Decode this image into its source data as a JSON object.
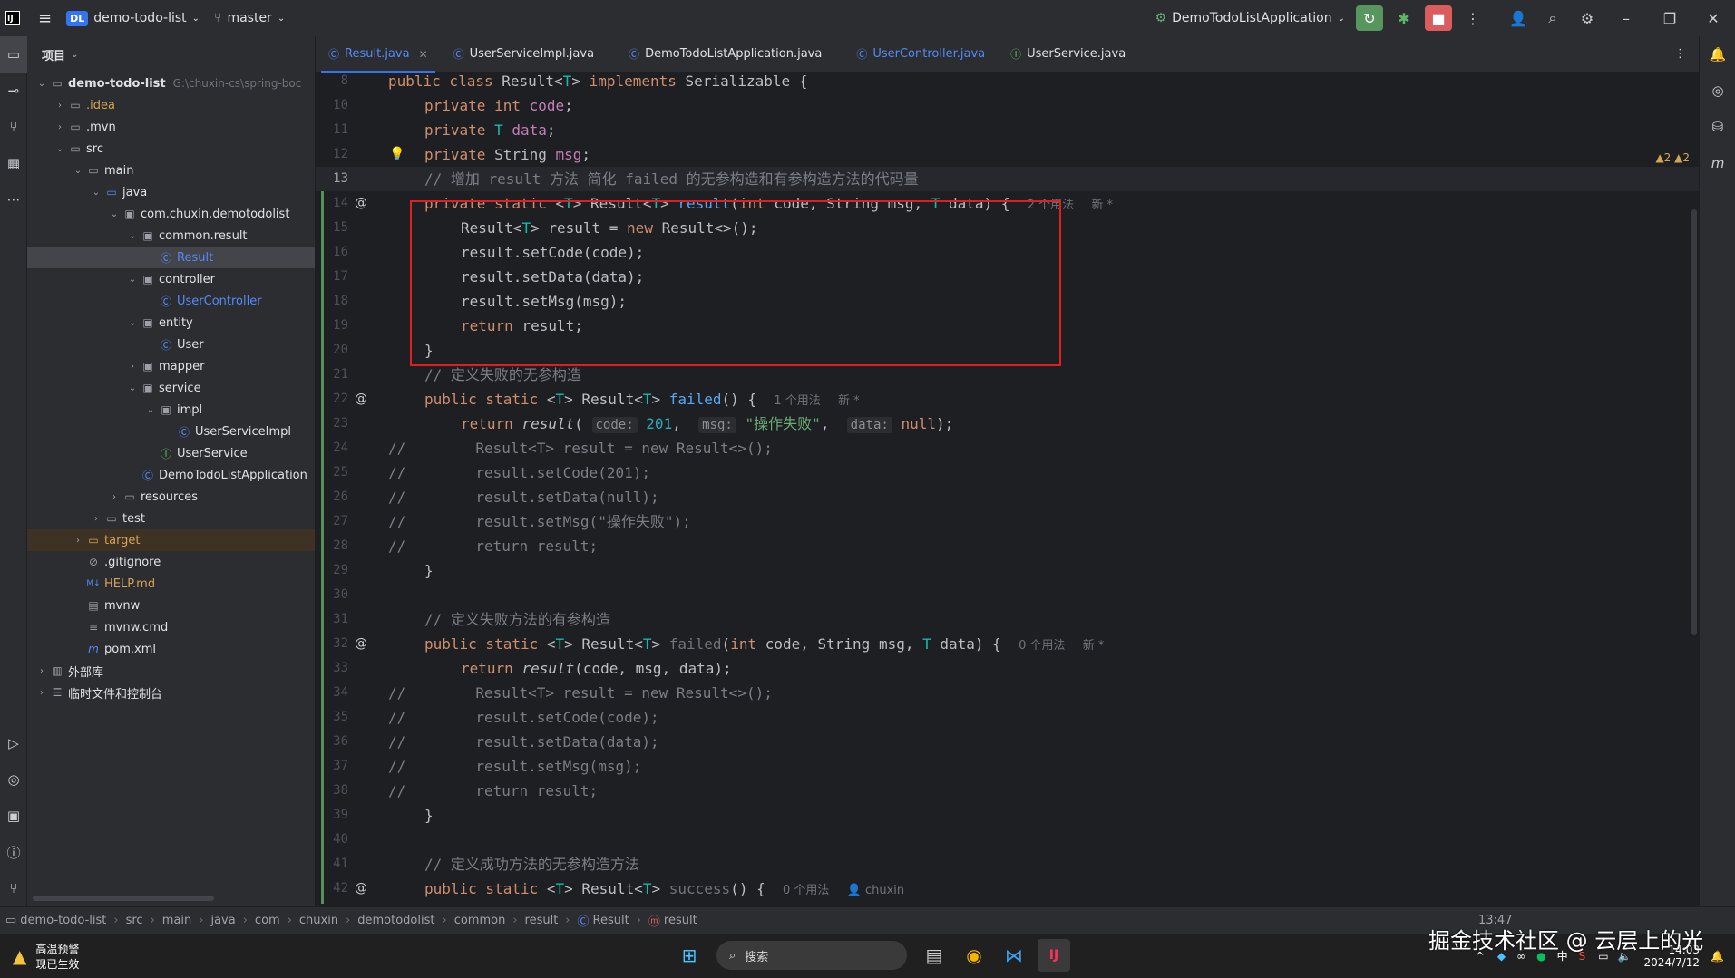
{
  "titlebar": {
    "project_badge": "DL",
    "project_name": "demo-todo-list",
    "branch": "master",
    "run_config": "DemoTodoListApplication"
  },
  "project_panel": {
    "title": "项目",
    "root_name": "demo-todo-list",
    "root_path": "G:\\chuxin-cs\\spring-boc",
    "items": [
      {
        "label": ".idea"
      },
      {
        "label": ".mvn"
      },
      {
        "label": "src"
      },
      {
        "label": "main"
      },
      {
        "label": "java"
      },
      {
        "label": "com.chuxin.demotodolist"
      },
      {
        "label": "common.result"
      },
      {
        "label": "Result"
      },
      {
        "label": "controller"
      },
      {
        "label": "UserController"
      },
      {
        "label": "entity"
      },
      {
        "label": "User"
      },
      {
        "label": "mapper"
      },
      {
        "label": "service"
      },
      {
        "label": "impl"
      },
      {
        "label": "UserServiceImpl"
      },
      {
        "label": "UserService"
      },
      {
        "label": "DemoTodoListApplication"
      },
      {
        "label": "resources"
      },
      {
        "label": "test"
      },
      {
        "label": "target"
      },
      {
        "label": ".gitignore"
      },
      {
        "label": "HELP.md"
      },
      {
        "label": "mvnw"
      },
      {
        "label": "mvnw.cmd"
      },
      {
        "label": "pom.xml"
      },
      {
        "label": "外部库"
      },
      {
        "label": "临时文件和控制台"
      }
    ]
  },
  "tabs": [
    {
      "label": "Result.java"
    },
    {
      "label": "UserServiceImpl.java"
    },
    {
      "label": "DemoTodoListApplication.java"
    },
    {
      "label": "UserController.java"
    },
    {
      "label": "UserService.java"
    }
  ],
  "editor": {
    "inspections": "▲2  ▲2",
    "line_numbers": [
      "8",
      "10",
      "11",
      "12",
      "13",
      "14",
      "15",
      "16",
      "17",
      "18",
      "19",
      "20",
      "21",
      "22",
      "23",
      "24",
      "25",
      "26",
      "27",
      "28",
      "29",
      "30",
      "31",
      "32",
      "33",
      "34",
      "35",
      "36",
      "37",
      "38",
      "39",
      "40",
      "41",
      "42"
    ],
    "hints": {
      "usages_2": "2 个用法",
      "usages_1": "1 个用法",
      "usages_0": "0 个用法",
      "new": "新 *",
      "author": "chuxin",
      "param_code": "code:",
      "param_msg": "msg:",
      "param_data": "data:"
    },
    "strings": {
      "fail_msg": "\"操作失败\"",
      "comment_13": "// 增加 result 方法 简化 failed 的无参构造和有参构造方法的代码量",
      "comment_21": "// 定义失败的无参构造",
      "comment_31": "// 定义失败方法的有参构造",
      "comment_41": "// 定义成功方法的无参构造方法",
      "comment_27": "//        result.setMsg(\"操作失败\");"
    }
  },
  "breadcrumb": [
    "demo-todo-list",
    "src",
    "main",
    "java",
    "com",
    "chuxin",
    "demotodolist",
    "common",
    "result",
    "Result",
    "result"
  ],
  "status": {
    "time_in_status": "13:47"
  },
  "taskbar": {
    "weather_title": "高温预警",
    "weather_sub": "现已生效",
    "search_placeholder": "搜索",
    "ime": "中",
    "time": "14:03",
    "date": "2024/7/12"
  },
  "watermark": "掘金技术社区 @ 云层上的光",
  "colors": {
    "accent": "#3574f0",
    "selection_box": "#e02020",
    "run": "#57965c",
    "stop": "#db5c5c"
  }
}
